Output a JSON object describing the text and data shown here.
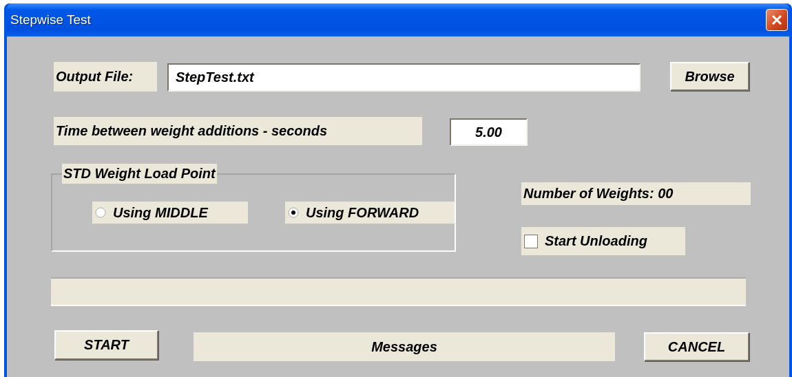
{
  "window": {
    "title": "Stepwise Test"
  },
  "output_file": {
    "label": "Output File:",
    "value": "StepTest.txt"
  },
  "browse_button": "Browse",
  "interval": {
    "label": "Time between weight additions - seconds",
    "value": "5.00"
  },
  "load_point": {
    "title": "STD Weight Load Point",
    "options": [
      {
        "label": "Using MIDDLE",
        "selected": false
      },
      {
        "label": "Using FORWARD",
        "selected": true
      }
    ]
  },
  "weights_count": "Number of Weights: 00",
  "start_unloading": {
    "label": "Start Unloading",
    "checked": false
  },
  "start_button": "START",
  "messages": "Messages",
  "cancel_button": "CANCEL"
}
